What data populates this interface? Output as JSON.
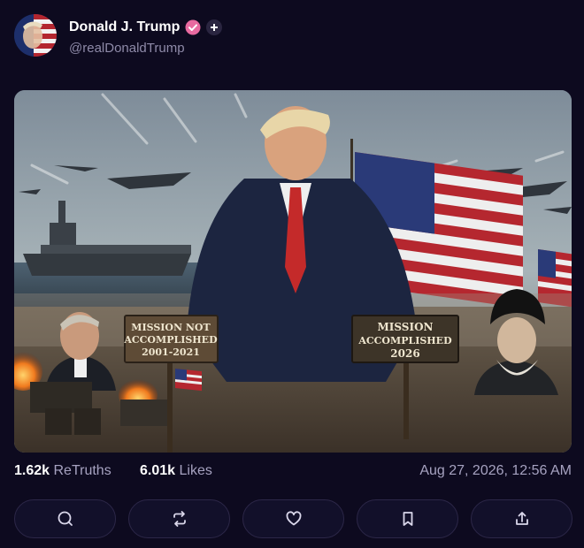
{
  "post": {
    "author_name": "Donald J. Trump",
    "author_handle": "@realDonaldTrump"
  },
  "image": {
    "sign_left": [
      "MISSION NOT",
      "ACCOMPLISHED",
      "2001-2021"
    ],
    "sign_right": [
      "MISSION",
      "ACCOMPLISHED",
      "2026"
    ]
  },
  "stats": {
    "retruths_count": "1.62k",
    "retruths_label": "ReTruths",
    "likes_count": "6.01k",
    "likes_label": "Likes",
    "timestamp": "Aug 27, 2026, 12:56 AM"
  },
  "actions": [
    {
      "icon": "reply-icon"
    },
    {
      "icon": "retruth-icon"
    },
    {
      "icon": "like-icon"
    },
    {
      "icon": "bookmark-icon"
    },
    {
      "icon": "share-icon"
    }
  ],
  "colors": {
    "background": "#0d0a1f",
    "verified_badge": "#e86aa0",
    "muted_text": "#a6a2c0"
  }
}
